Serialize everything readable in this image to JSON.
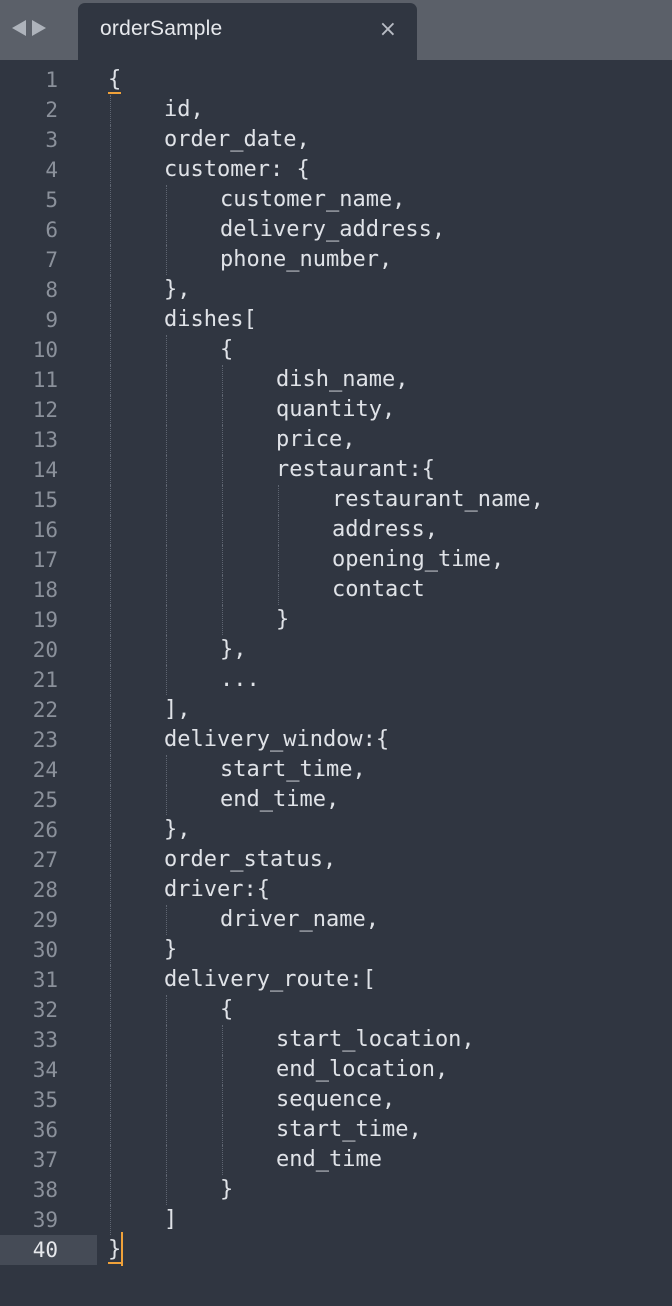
{
  "tab": {
    "title": "orderSample",
    "close_icon": "×",
    "back_icon": "triangle-left",
    "forward_icon": "triangle-right"
  },
  "editor": {
    "current_line": 40,
    "lines": [
      {
        "n": "1",
        "indent": 0,
        "text": "{"
      },
      {
        "n": "2",
        "indent": 1,
        "text": "id,"
      },
      {
        "n": "3",
        "indent": 1,
        "text": "order_date,"
      },
      {
        "n": "4",
        "indent": 1,
        "text": "customer: {"
      },
      {
        "n": "5",
        "indent": 2,
        "text": "customer_name,"
      },
      {
        "n": "6",
        "indent": 2,
        "text": "delivery_address,"
      },
      {
        "n": "7",
        "indent": 2,
        "text": "phone_number,"
      },
      {
        "n": "8",
        "indent": 1,
        "text": "},"
      },
      {
        "n": "9",
        "indent": 1,
        "text": "dishes["
      },
      {
        "n": "10",
        "indent": 2,
        "text": "{"
      },
      {
        "n": "11",
        "indent": 3,
        "text": "dish_name,"
      },
      {
        "n": "12",
        "indent": 3,
        "text": "quantity,"
      },
      {
        "n": "13",
        "indent": 3,
        "text": "price,"
      },
      {
        "n": "14",
        "indent": 3,
        "text": "restaurant:{"
      },
      {
        "n": "15",
        "indent": 4,
        "text": "restaurant_name,"
      },
      {
        "n": "16",
        "indent": 4,
        "text": "address,"
      },
      {
        "n": "17",
        "indent": 4,
        "text": "opening_time,"
      },
      {
        "n": "18",
        "indent": 4,
        "text": "contact"
      },
      {
        "n": "19",
        "indent": 3,
        "text": "}"
      },
      {
        "n": "20",
        "indent": 2,
        "text": "},"
      },
      {
        "n": "21",
        "indent": 2,
        "text": "..."
      },
      {
        "n": "22",
        "indent": 1,
        "text": "],"
      },
      {
        "n": "23",
        "indent": 1,
        "text": "delivery_window:{"
      },
      {
        "n": "24",
        "indent": 2,
        "text": "start_time,"
      },
      {
        "n": "25",
        "indent": 2,
        "text": "end_time,"
      },
      {
        "n": "26",
        "indent": 1,
        "text": "},"
      },
      {
        "n": "27",
        "indent": 1,
        "text": "order_status,"
      },
      {
        "n": "28",
        "indent": 1,
        "text": "driver:{"
      },
      {
        "n": "29",
        "indent": 2,
        "text": "driver_name,"
      },
      {
        "n": "30",
        "indent": 1,
        "text": "}"
      },
      {
        "n": "31",
        "indent": 1,
        "text": "delivery_route:["
      },
      {
        "n": "32",
        "indent": 2,
        "text": "{"
      },
      {
        "n": "33",
        "indent": 3,
        "text": "start_location,"
      },
      {
        "n": "34",
        "indent": 3,
        "text": "end_location,"
      },
      {
        "n": "35",
        "indent": 3,
        "text": "sequence,"
      },
      {
        "n": "36",
        "indent": 3,
        "text": "start_time,"
      },
      {
        "n": "37",
        "indent": 3,
        "text": "end_time"
      },
      {
        "n": "38",
        "indent": 2,
        "text": "}"
      },
      {
        "n": "39",
        "indent": 1,
        "text": "]"
      },
      {
        "n": "40",
        "indent": 0,
        "text": "}"
      }
    ]
  },
  "colors": {
    "background": "#303641",
    "tabbar": "#5b6069",
    "text": "#dfe2e7",
    "line_number": "#8b919b",
    "bracket_match": "#f0a23a"
  }
}
